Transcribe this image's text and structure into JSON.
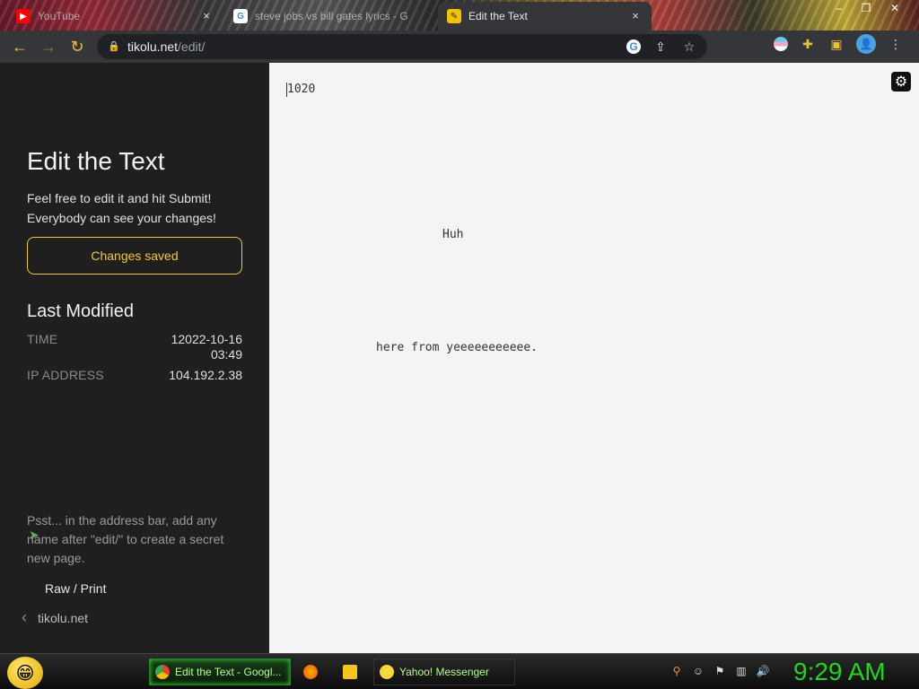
{
  "browser": {
    "tabs": [
      {
        "title": "YouTube",
        "icon": "youtube-icon",
        "active": false
      },
      {
        "title": "steve jobs vs bill gates lyrics - G",
        "icon": "google-icon",
        "active": false
      },
      {
        "title": "Edit the Text",
        "icon": "edit-icon",
        "active": true
      }
    ],
    "close_glyph": "×",
    "window_controls": [
      "–",
      "❐",
      "✕"
    ],
    "url": {
      "host": "tikolu.net",
      "path": "/edit/"
    }
  },
  "sidebar": {
    "title": "Edit the Text",
    "intro": "Feel free to edit it and hit Submit! Everybody can see your changes!",
    "status_button": "Changes saved",
    "last_modified_heading": "Last Modified",
    "time_label": "TIME",
    "time_value": "12022-10-16 03:49",
    "ip_label": "IP ADDRESS",
    "ip_value": "104.192.2.38",
    "tip": "Psst... in the address bar, add any name after \"edit/\" to create a secret new page.",
    "raw_link": "Raw / Print",
    "home_link": "tikolu.net",
    "accent": "#f0c930"
  },
  "editor": {
    "lines": [
      "1020",
      "Huh",
      "here from yeeeeeeeeeee."
    ]
  },
  "taskbar": {
    "items": [
      {
        "label": "Edit the Text - Googl...",
        "icon": "chrome-icon"
      },
      {
        "label": "",
        "icon": "firefox-icon"
      },
      {
        "label": "",
        "icon": "folder-icon"
      },
      {
        "label": "Yahoo! Messenger",
        "icon": "yahoo-messenger-icon"
      }
    ],
    "clock": "9:29 AM",
    "clock_color": "#1dd71d"
  }
}
